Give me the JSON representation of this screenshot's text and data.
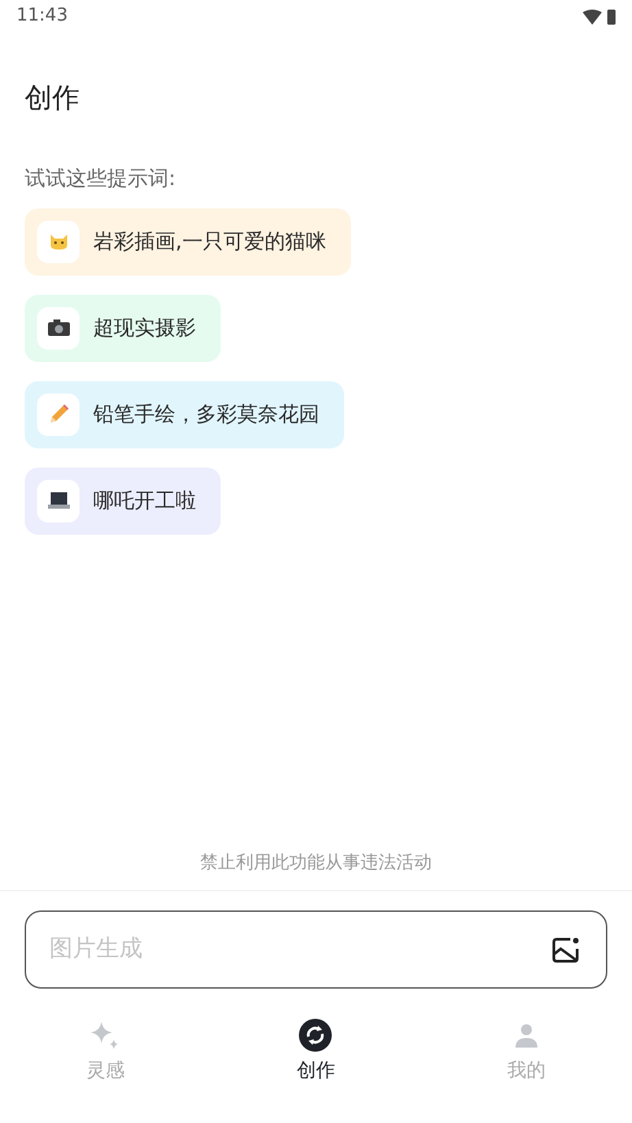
{
  "status_bar": {
    "time": "11:43"
  },
  "title": "创作",
  "prompts_heading": "试试这些提示词:",
  "prompts": [
    {
      "kind": "cat",
      "text": "岩彩插画,一只可爱的猫咪",
      "color": "#fff3e2"
    },
    {
      "kind": "camera",
      "text": "超现实摄影",
      "color": "#e5fbef"
    },
    {
      "kind": "pencil",
      "text": "铅笔手绘，多彩莫奈花园",
      "color": "#e1f5fd"
    },
    {
      "kind": "laptop",
      "text": "哪吒开工啦",
      "color": "#eceefd"
    }
  ],
  "disclaimer": "禁止利用此功能从事违法活动",
  "input": {
    "placeholder": "图片生成"
  },
  "nav": [
    {
      "kind": "sparkle",
      "label": "灵感",
      "selected": false
    },
    {
      "kind": "create",
      "label": "创作",
      "selected": true
    },
    {
      "kind": "person",
      "label": "我的",
      "selected": false
    }
  ]
}
